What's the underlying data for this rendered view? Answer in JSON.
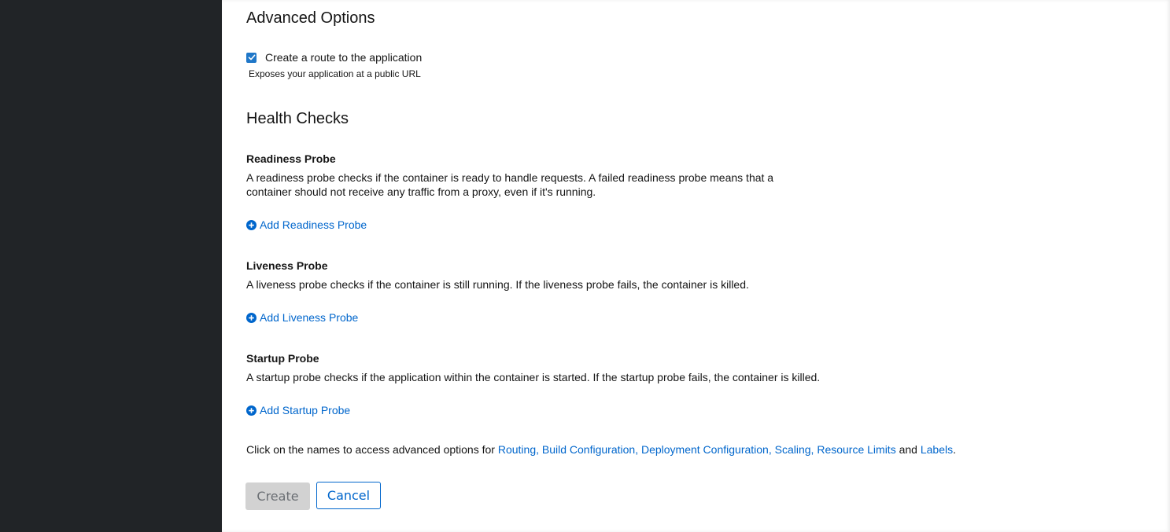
{
  "advanced_options": {
    "title": "Advanced Options",
    "route_checkbox": {
      "label": "Create a route to the application",
      "checked": true,
      "helper": "Exposes your application at a public URL"
    }
  },
  "health_checks": {
    "title": "Health Checks",
    "readiness": {
      "title": "Readiness Probe",
      "description_line1": "A readiness probe checks if the container is ready to handle requests. A failed readiness probe means that a",
      "description_line2": "container should not receive any traffic from a proxy, even if it's running.",
      "add_label": "Add Readiness Probe"
    },
    "liveness": {
      "title": "Liveness Probe",
      "description": "A liveness probe checks if the container is still running. If the liveness probe fails, the container is killed.",
      "add_label": "Add Liveness Probe"
    },
    "startup": {
      "title": "Startup Probe",
      "description": "A startup probe checks if the application within the container is started. If the startup probe fails, the container is killed.",
      "add_label": "Add Startup Probe"
    }
  },
  "advanced_links": {
    "prefix": "Click on the names to access advanced options for ",
    "routing": "Routing",
    "build_configuration": "Build Configuration",
    "deployment_configuration": "Deployment Configuration",
    "scaling": "Scaling",
    "resource_limits": "Resource Limits",
    "labels": "Labels",
    "separator": ", ",
    "and": " and ",
    "suffix": "."
  },
  "actions": {
    "create_label": "Create",
    "cancel_label": "Cancel"
  },
  "colors": {
    "sidebar_bg": "#212427",
    "link": "#0066cc",
    "checkbox": "#1f77c8",
    "disabled_button_bg": "#d2d2d2"
  }
}
